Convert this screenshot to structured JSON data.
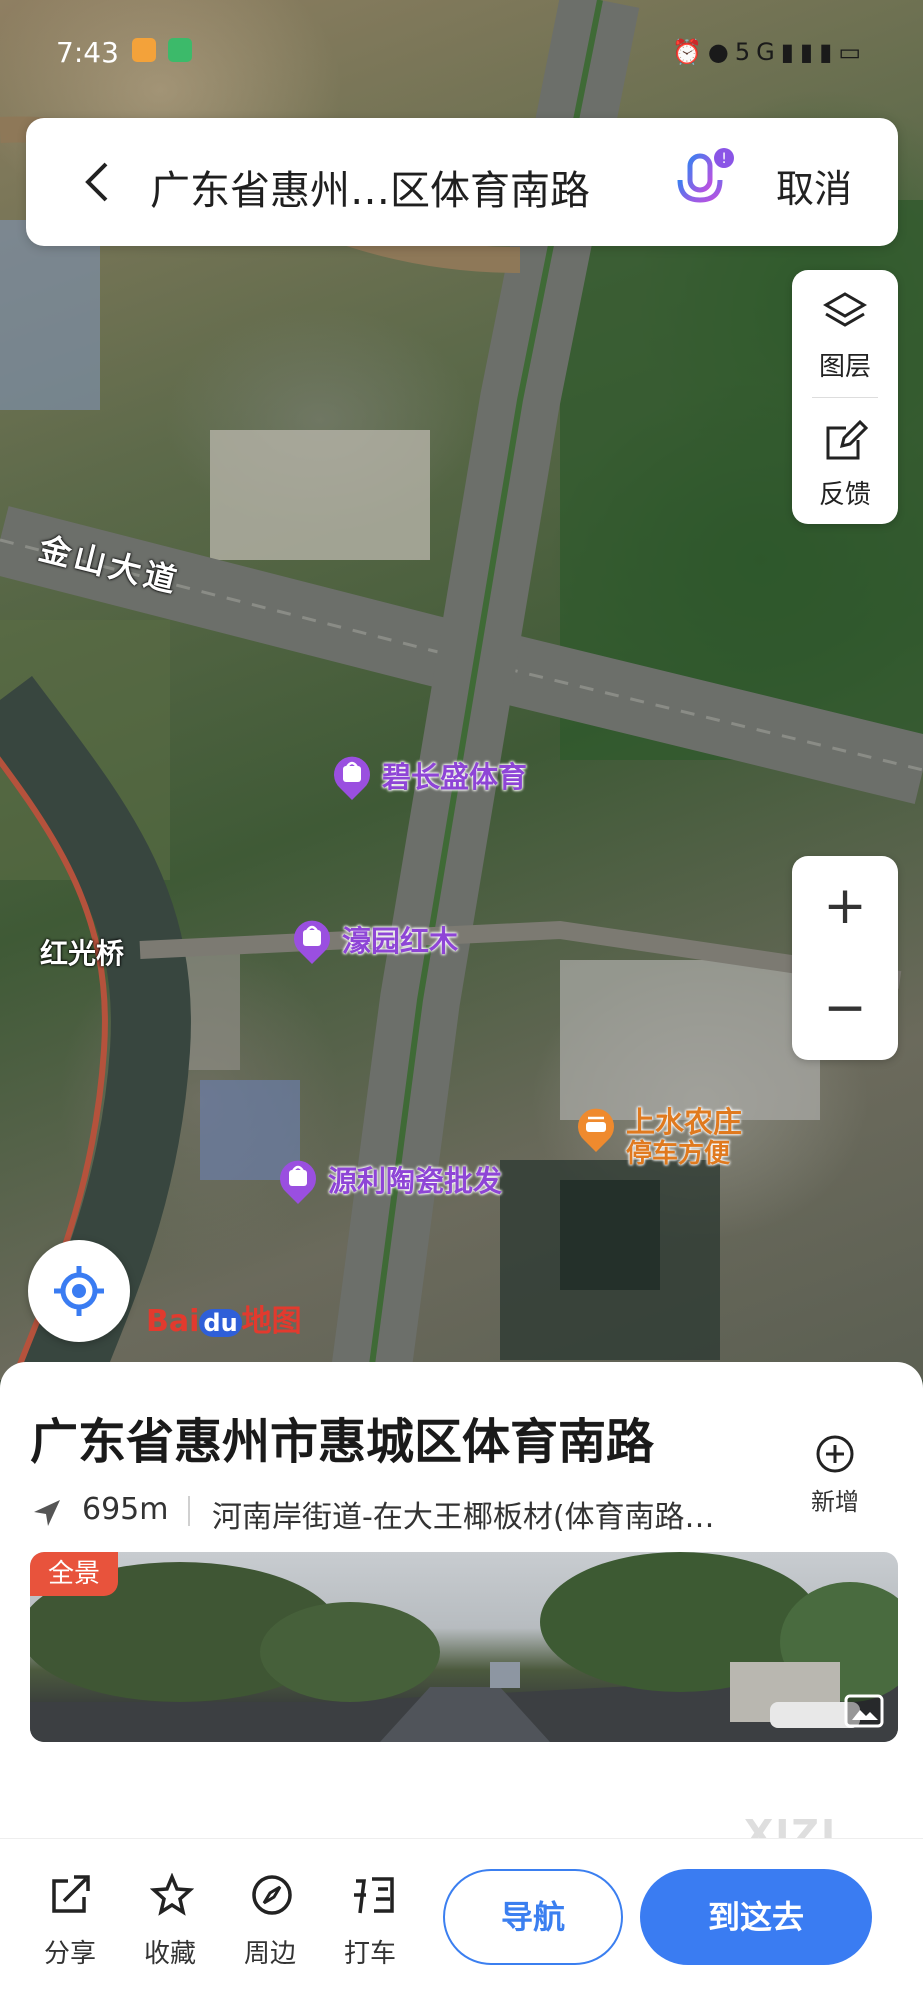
{
  "status_bar": {
    "time": "7:43",
    "network": "5G"
  },
  "search": {
    "query": "广东省惠州…区体育南路",
    "cancel_label": "取消",
    "back_icon": "chevron-left-icon",
    "mic_icon": "microphone-icon"
  },
  "tools": {
    "layers_label": "图层",
    "feedback_label": "反馈",
    "zoom_in": "+",
    "zoom_out": "−"
  },
  "map": {
    "road_labels": [
      "金山大道",
      "红光桥"
    ],
    "pois": [
      {
        "name": "碧长盛体育",
        "type": "shopping"
      },
      {
        "name": "濠园红木",
        "type": "shopping"
      },
      {
        "name": "源利陶瓷批发",
        "type": "shopping"
      },
      {
        "name": "上水农庄",
        "sub": "停车方便",
        "type": "restaurant"
      }
    ],
    "logo": {
      "bai": "Bai",
      "du": "du",
      "ditu": "地图"
    }
  },
  "place": {
    "title": "广东省惠州市惠城区体育南路",
    "add_label": "新增",
    "distance": "695m",
    "address": "河南岸街道-在大王椰板材(体育南路…",
    "panorama_tag": "全景"
  },
  "actions": {
    "share": "分享",
    "favorite": "收藏",
    "nearby": "周边",
    "taxi": "打车",
    "navigate": "导航",
    "go_here": "到这去"
  },
  "watermark": "XIZI",
  "colors": {
    "accent": "#3a7cf2",
    "poi_purple": "#8e45d6",
    "poi_orange": "#e07a1f",
    "tag_red": "#e8533c"
  }
}
